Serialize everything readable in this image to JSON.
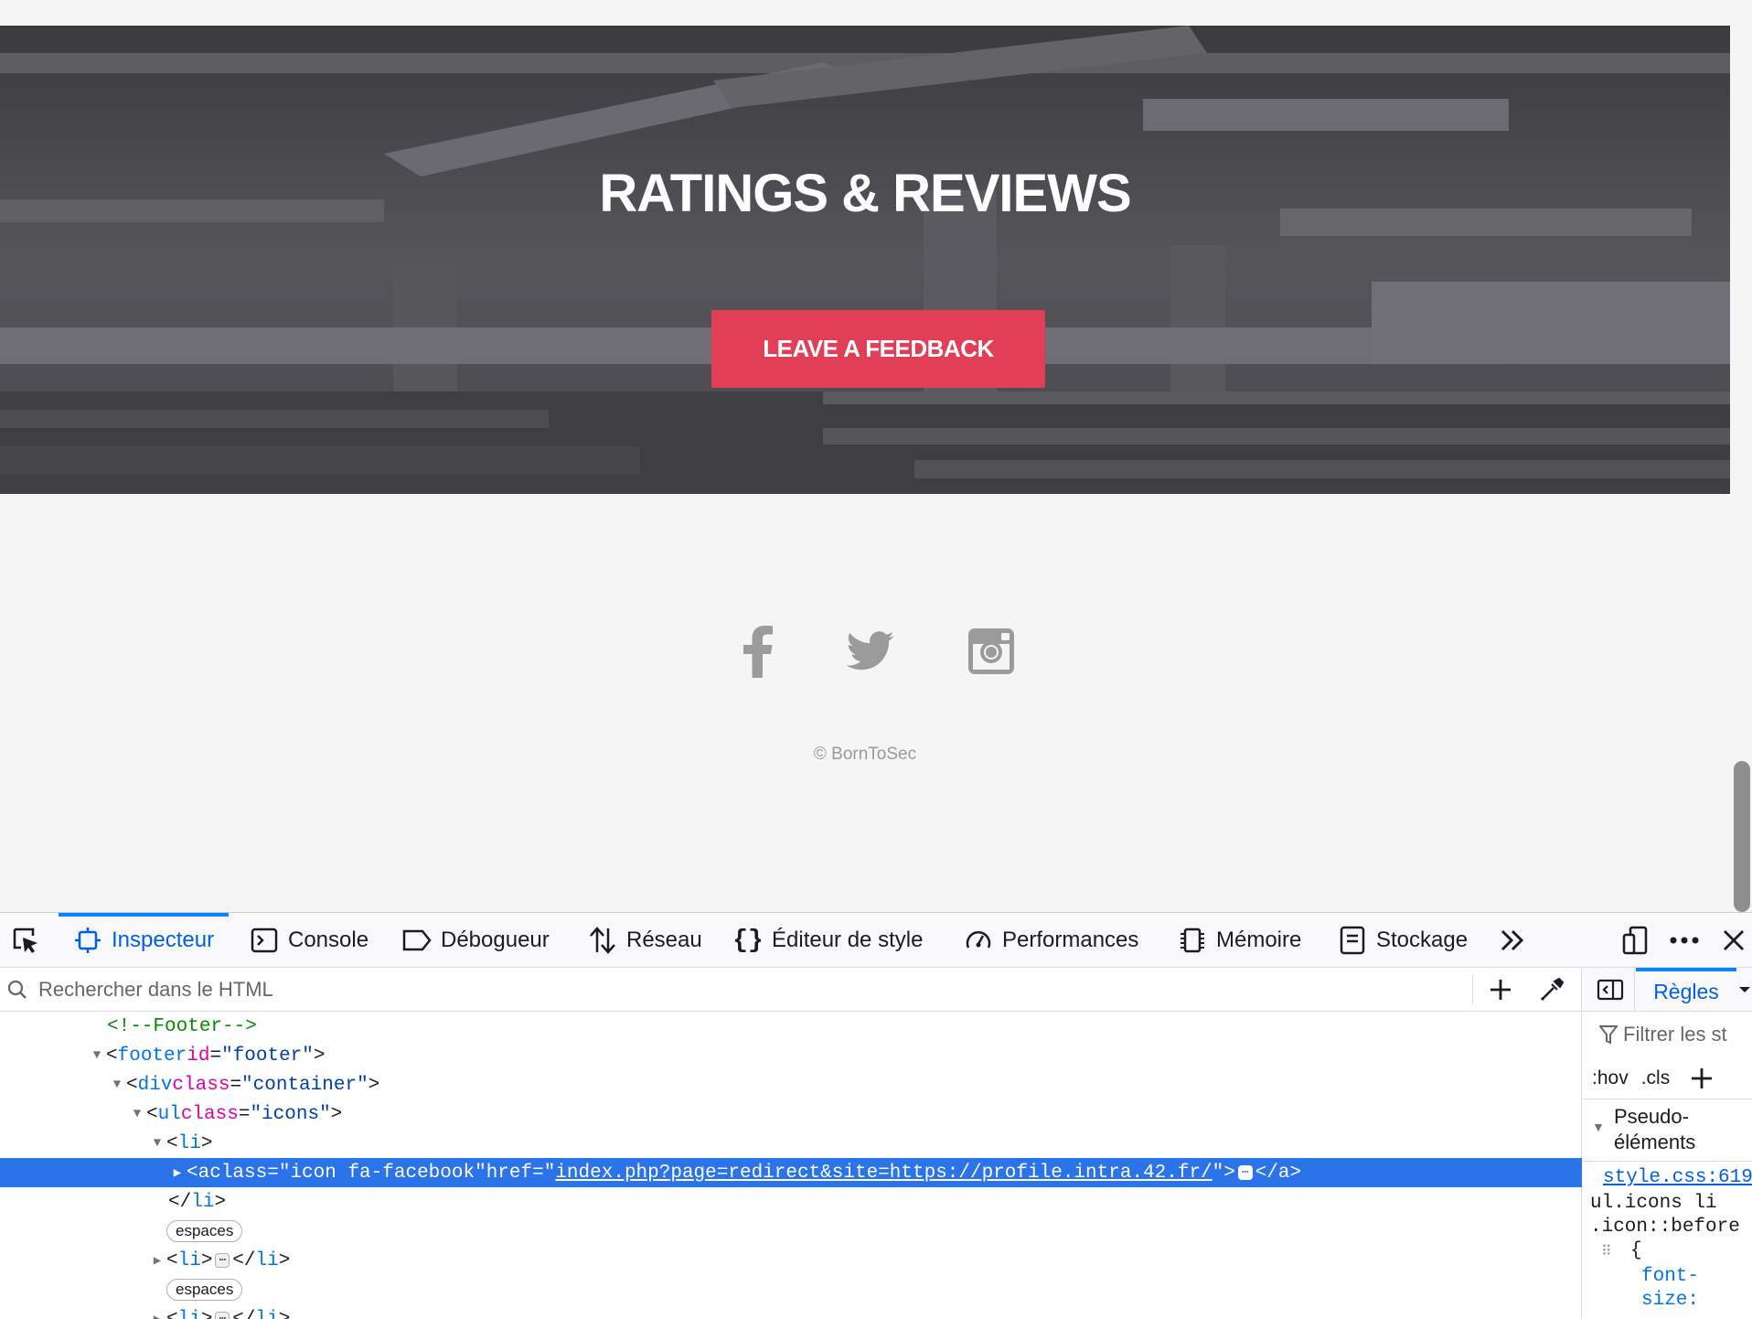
{
  "hero": {
    "title": "RATINGS & REVIEWS",
    "button_label": "LEAVE A FEEDBACK",
    "button_color": "#e13f57"
  },
  "footer": {
    "social": [
      {
        "icon": "facebook-icon"
      },
      {
        "icon": "twitter-icon"
      },
      {
        "icon": "instagram-icon"
      }
    ],
    "copyright": "© BornToSec"
  },
  "devtools": {
    "tabs": [
      {
        "label": "Inspecteur",
        "icon": "inspector-icon",
        "active": true
      },
      {
        "label": "Console",
        "icon": "console-icon"
      },
      {
        "label": "Débogueur",
        "icon": "debugger-icon"
      },
      {
        "label": "Réseau",
        "icon": "network-icon"
      },
      {
        "label": "Éditeur de style",
        "icon": "style-editor-icon"
      },
      {
        "label": "Performances",
        "icon": "performance-icon"
      },
      {
        "label": "Mémoire",
        "icon": "memory-icon"
      },
      {
        "label": "Stockage",
        "icon": "storage-icon"
      }
    ],
    "search_placeholder": "Rechercher dans le HTML",
    "tree": {
      "comment": "<!--Footer-->",
      "footer_tag": "footer",
      "footer_attr": "id",
      "footer_val": "\"footer\"",
      "div_tag": "div",
      "div_attr": "class",
      "div_val": "\"container\"",
      "ul_tag": "ul",
      "ul_attr": "class",
      "ul_val": "\"icons\"",
      "li_tag": "li",
      "a_tag": "a",
      "a_class_attr": "class",
      "a_class_val": "\"icon fa-facebook\"",
      "a_href_attr": "href",
      "a_href_val": "index.php?page=redirect&site=https://profile.intra.42.fr/",
      "ellipsis": "⋯",
      "whitespace_badge": "espaces"
    },
    "rules": {
      "tab_label": "Règles",
      "filter_placeholder": "Filtrer les st",
      "hov": ":hov",
      "cls": ".cls",
      "pseudo_line1": "Pseudo-",
      "pseudo_line2": "éléments",
      "source": "style.css:619",
      "selector_line1": "ul.icons li",
      "selector_line2": ".icon::before",
      "brace": "{",
      "prop_line1": "font-",
      "prop_line2": "size:"
    }
  }
}
